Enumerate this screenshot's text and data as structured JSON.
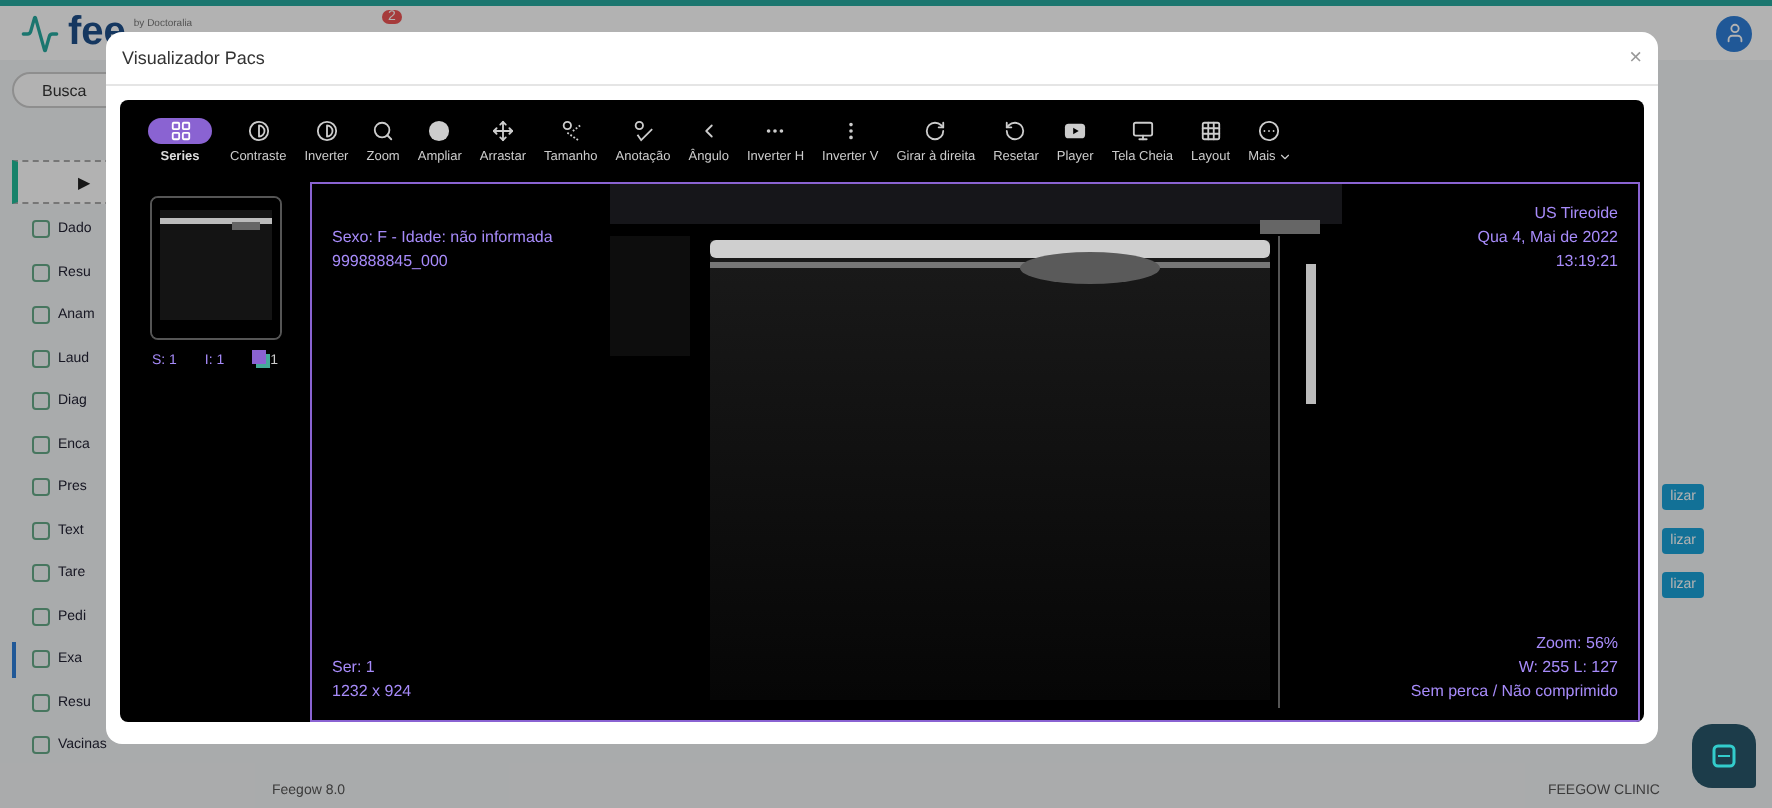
{
  "app": {
    "logo": "fee",
    "logo_by": "by Doctoralia",
    "notification_count": "2",
    "search": {
      "placeholder": "Busca"
    },
    "start_button": "▶",
    "sidebar": [
      {
        "label": "Dado",
        "selected": false
      },
      {
        "label": "Resu",
        "selected": false
      },
      {
        "label": "Anam",
        "selected": false
      },
      {
        "label": "Laud",
        "selected": false
      },
      {
        "label": "Diag",
        "selected": false
      },
      {
        "label": "Enca",
        "selected": false
      },
      {
        "label": "Pres",
        "selected": false
      },
      {
        "label": "Text",
        "selected": false
      },
      {
        "label": "Tare",
        "selected": false
      },
      {
        "label": "Pedi",
        "selected": false
      },
      {
        "label": "Exa",
        "selected": true
      },
      {
        "label": "Resu",
        "selected": false
      },
      {
        "label": "Vacinas",
        "selected": false
      }
    ],
    "row_buttons": [
      "lizar",
      "lizar",
      "lizar"
    ],
    "footer_left": "Feegow 8.0",
    "footer_right": "FEEGOW CLINIC"
  },
  "modal": {
    "title": "Visualizador Pacs",
    "close": "×",
    "tools": [
      {
        "label": "Series",
        "selected": true,
        "menu": false
      },
      {
        "label": "Contraste",
        "selected": false,
        "menu": false
      },
      {
        "label": "Inverter",
        "selected": false,
        "menu": false
      },
      {
        "label": "Zoom",
        "selected": false,
        "menu": false
      },
      {
        "label": "Ampliar",
        "selected": false,
        "menu": false
      },
      {
        "label": "Arrastar",
        "selected": false,
        "menu": false
      },
      {
        "label": "Tamanho",
        "selected": false,
        "menu": false
      },
      {
        "label": "Anotação",
        "selected": false,
        "menu": false
      },
      {
        "label": "Ângulo",
        "selected": false,
        "menu": false
      },
      {
        "label": "Inverter H",
        "selected": false,
        "menu": false
      },
      {
        "label": "Inverter V",
        "selected": false,
        "menu": false
      },
      {
        "label": "Girar à direita",
        "selected": false,
        "menu": false
      },
      {
        "label": "Resetar",
        "selected": false,
        "menu": false
      },
      {
        "label": "Player",
        "selected": false,
        "menu": false
      },
      {
        "label": "Tela Cheia",
        "selected": false,
        "menu": false
      },
      {
        "label": "Layout",
        "selected": false,
        "menu": false
      },
      {
        "label": "Mais",
        "selected": false,
        "menu": true
      }
    ],
    "series": {
      "series_label": "S: 1",
      "instance_label": "I: 1",
      "stack_count": "1"
    },
    "overlay": {
      "top_left": [
        "Sexo: F - Idade: não informada",
        "999888845_000"
      ],
      "top_right": [
        "US Tireoide",
        "Qua 4, Mai de 2022",
        "13:19:21"
      ],
      "bottom_left": [
        "Ser: 1",
        "1232 x 924"
      ],
      "bottom_right": [
        "Zoom: 56%",
        "W: 255 L: 127",
        "Sem perca / Não comprimido"
      ]
    }
  }
}
